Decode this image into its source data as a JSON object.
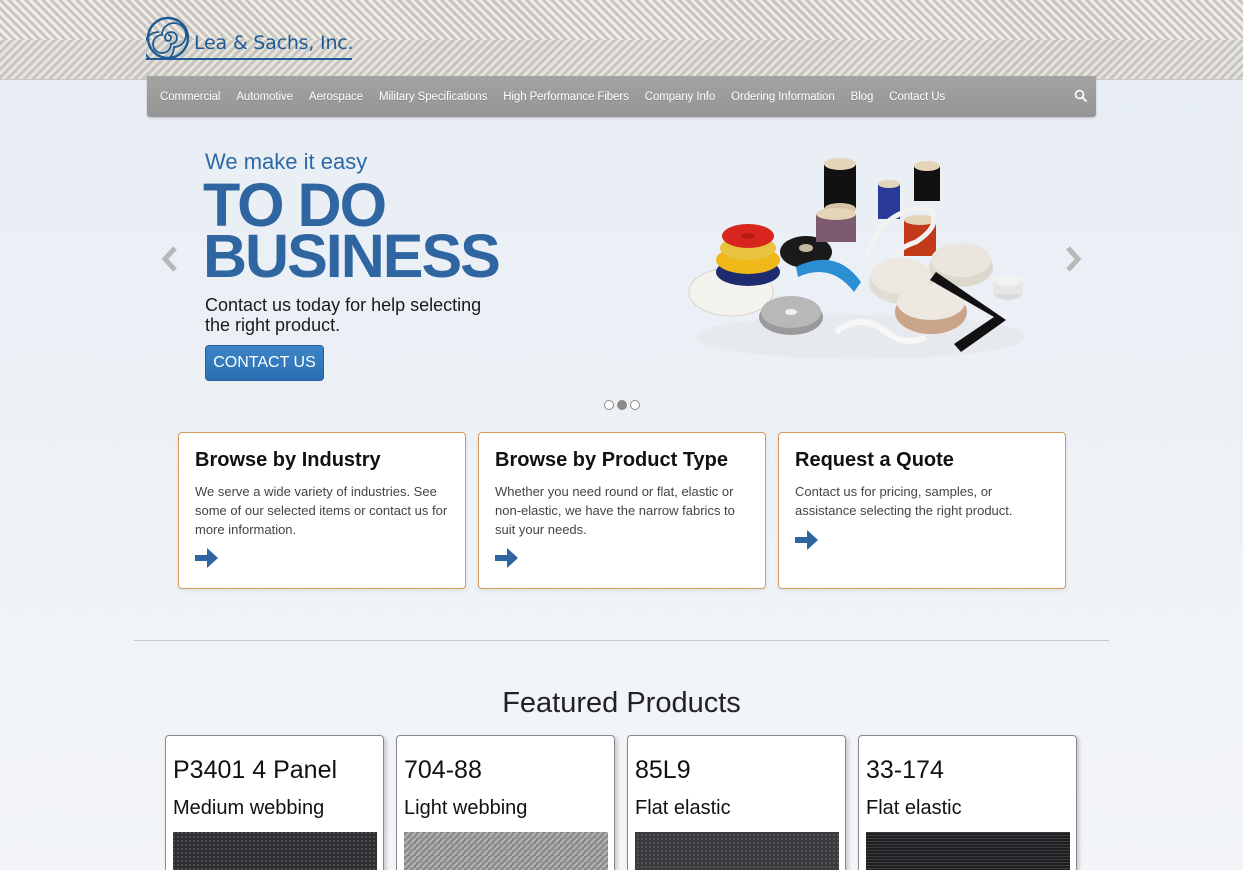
{
  "brand": {
    "name": "Lea & Sachs, Inc."
  },
  "nav": {
    "items": [
      "Commercial",
      "Automotive",
      "Aerospace",
      "Military Specifications",
      "High Performance Fibers",
      "Company Info",
      "Ordering Information",
      "Blog",
      "Contact Us"
    ],
    "search_icon": "search-icon"
  },
  "hero": {
    "subtitle": "We make it easy",
    "title_line1": "TO DO",
    "title_line2": "BUSINESS",
    "body": "Contact us today for help selecting the right product.",
    "button_label": "CONTACT US",
    "slide_count": 3,
    "active_slide": 2
  },
  "cards": [
    {
      "title": "Browse by Industry",
      "text": "We serve a wide variety of industries. See some of our selected items or contact us for more information.",
      "icon": "arrow-right-icon"
    },
    {
      "title": "Browse by Product Type",
      "text": "Whether you need round or flat, elastic or non-elastic, we have the narrow fabrics to suit your needs.",
      "icon": "arrow-right-icon"
    },
    {
      "title": "Request a Quote",
      "text": "Contact us for pricing, samples, or assistance selecting the right product.",
      "icon": "arrow-right-icon"
    }
  ],
  "featured": {
    "title": "Featured Products",
    "products": [
      {
        "sku": "P3401 4 Panel",
        "type": "Medium webbing"
      },
      {
        "sku": "704-88",
        "type": "Light webbing"
      },
      {
        "sku": "85L9",
        "type": "Flat elastic"
      },
      {
        "sku": "33-174",
        "type": "Flat elastic"
      }
    ]
  },
  "colors": {
    "brand_blue": "#2f65a0",
    "card_border": "#d49a5a",
    "nav_bg": "#9c9c9c",
    "button_blue": "#3279bd"
  }
}
